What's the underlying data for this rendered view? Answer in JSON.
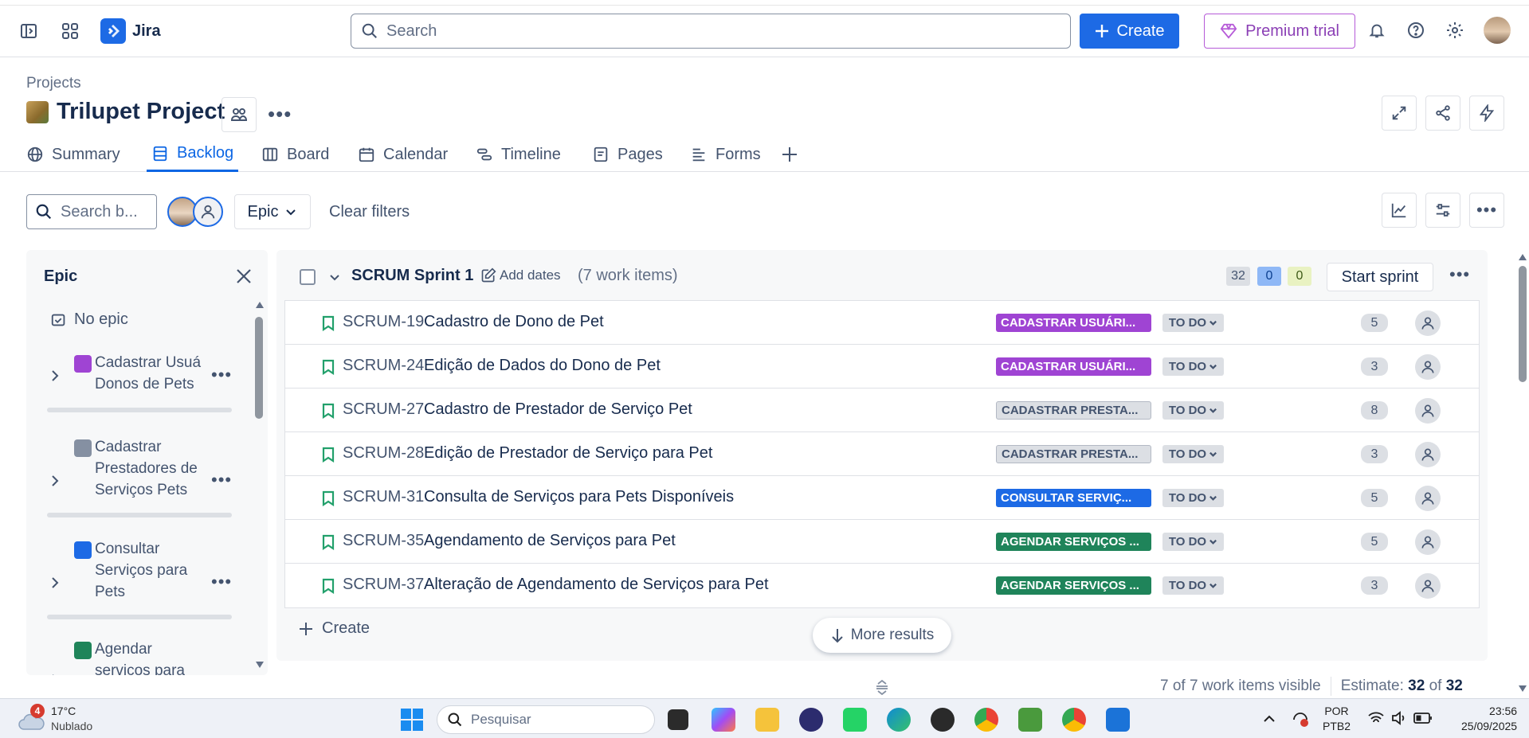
{
  "app": {
    "name": "Jira"
  },
  "search": {
    "placeholder": "Search"
  },
  "top": {
    "create_label": "Create",
    "premium_label": "Premium trial"
  },
  "breadcrumb": "Projects",
  "project": {
    "title": "Trilupet Project"
  },
  "tabs": [
    {
      "label": "Summary"
    },
    {
      "label": "Backlog"
    },
    {
      "label": "Board"
    },
    {
      "label": "Calendar"
    },
    {
      "label": "Timeline"
    },
    {
      "label": "Pages"
    },
    {
      "label": "Forms"
    }
  ],
  "filters": {
    "search_placeholder": "Search b...",
    "epic_label": "Epic",
    "clear_label": "Clear filters"
  },
  "epic_panel": {
    "title": "Epic",
    "no_epic": "No epic",
    "items": [
      {
        "name": "Cadastrar Usuá\nDonos de Pets",
        "color": "#9f44d3"
      },
      {
        "name": "Cadastrar\nPrestadores de\nServiços Pets",
        "color": "#8590a2"
      },
      {
        "name": "Consultar\nServiços para\nPets",
        "color": "#1d6ae5"
      },
      {
        "name": "Agendar\nserviços para",
        "color": "#1f845a"
      }
    ]
  },
  "sprint": {
    "name": "SCRUM Sprint 1",
    "add_dates": "Add dates",
    "count": "(7 work items)",
    "todo_points": "32",
    "inprogress_points": "0",
    "done_points": "0",
    "start_label": "Start sprint",
    "create_label": "Create",
    "issues": [
      {
        "key": "SCRUM-19",
        "summary": "Cadastro de Dono de Pet",
        "epic": "CADASTRAR USUÁRI...",
        "epic_bg": "#9f44d3",
        "epic_fg": "#ffffff",
        "status": "TO DO",
        "points": "5"
      },
      {
        "key": "SCRUM-24",
        "summary": "Edição de Dados do Dono de Pet",
        "epic": "CADASTRAR USUÁRI...",
        "epic_bg": "#9f44d3",
        "epic_fg": "#ffffff",
        "status": "TO DO",
        "points": "3"
      },
      {
        "key": "SCRUM-27",
        "summary": "Cadastro de Prestador de Serviço Pet",
        "epic": "CADASTRAR PRESTA...",
        "epic_bg": "#dcdfe4",
        "epic_fg": "#44546f",
        "status": "TO DO",
        "points": "8"
      },
      {
        "key": "SCRUM-28",
        "summary": "Edição de Prestador de Serviço para Pet",
        "epic": "CADASTRAR PRESTA...",
        "epic_bg": "#dcdfe4",
        "epic_fg": "#44546f",
        "status": "TO DO",
        "points": "3"
      },
      {
        "key": "SCRUM-31",
        "summary": "Consulta de Serviços para Pets Disponíveis",
        "epic": "CONSULTAR SERVIÇ...",
        "epic_bg": "#1d6ae5",
        "epic_fg": "#ffffff",
        "status": "TO DO",
        "points": "5"
      },
      {
        "key": "SCRUM-35",
        "summary": "Agendamento de Serviços para Pet",
        "epic": "AGENDAR SERVIÇOS ...",
        "epic_bg": "#1f845a",
        "epic_fg": "#ffffff",
        "status": "TO DO",
        "points": "5"
      },
      {
        "key": "SCRUM-37",
        "summary": "Alteração de Agendamento de Serviços para Pet",
        "epic": "AGENDAR SERVIÇOS ...",
        "epic_bg": "#1f845a",
        "epic_fg": "#ffffff",
        "status": "TO DO",
        "points": "3"
      }
    ]
  },
  "more_results": "More results",
  "footer": {
    "visible": "7 of 7 work items visible",
    "estimate_label": "Estimate:",
    "estimate_value": "32",
    "estimate_of": "of",
    "estimate_total": "32"
  },
  "taskbar": {
    "weather_badge": "4",
    "temperature": "17°C",
    "condition": "Nublado",
    "search_placeholder": "Pesquisar",
    "lang1": "POR",
    "lang2": "PTB2",
    "time": "23:56",
    "date": "25/09/2025"
  }
}
